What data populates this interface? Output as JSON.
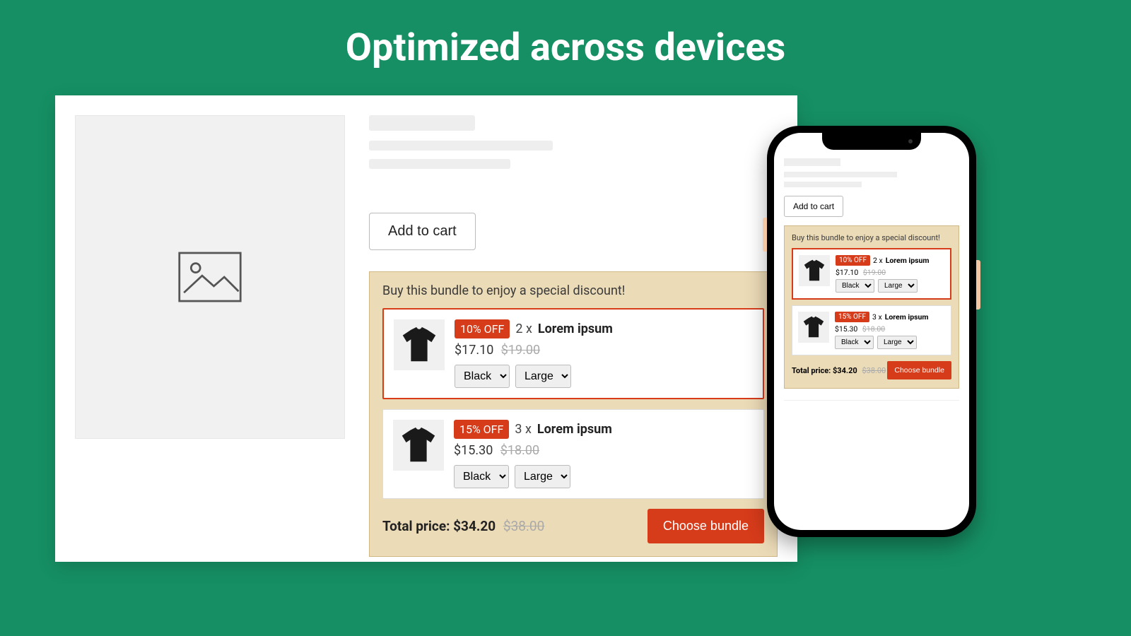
{
  "headline": "Optimized across devices",
  "addToCart": "Add to cart",
  "bundle": {
    "heading": "Buy this bundle to enjoy a special discount!",
    "items": [
      {
        "badge": "10% OFF",
        "qty": "2 x",
        "name": "Lorem ipsum",
        "price": "$17.10",
        "oldPrice": "$19.00",
        "color": "Black",
        "size": "Large"
      },
      {
        "badge": "15% OFF",
        "qty": "3 x",
        "name": "Lorem ipsum",
        "price": "$15.30",
        "oldPrice": "$18.00",
        "color": "Black",
        "size": "Large"
      }
    ],
    "totalLabel": "Total price:",
    "total": "$34.20",
    "totalOld": "$38.00",
    "cta": "Choose bundle"
  }
}
